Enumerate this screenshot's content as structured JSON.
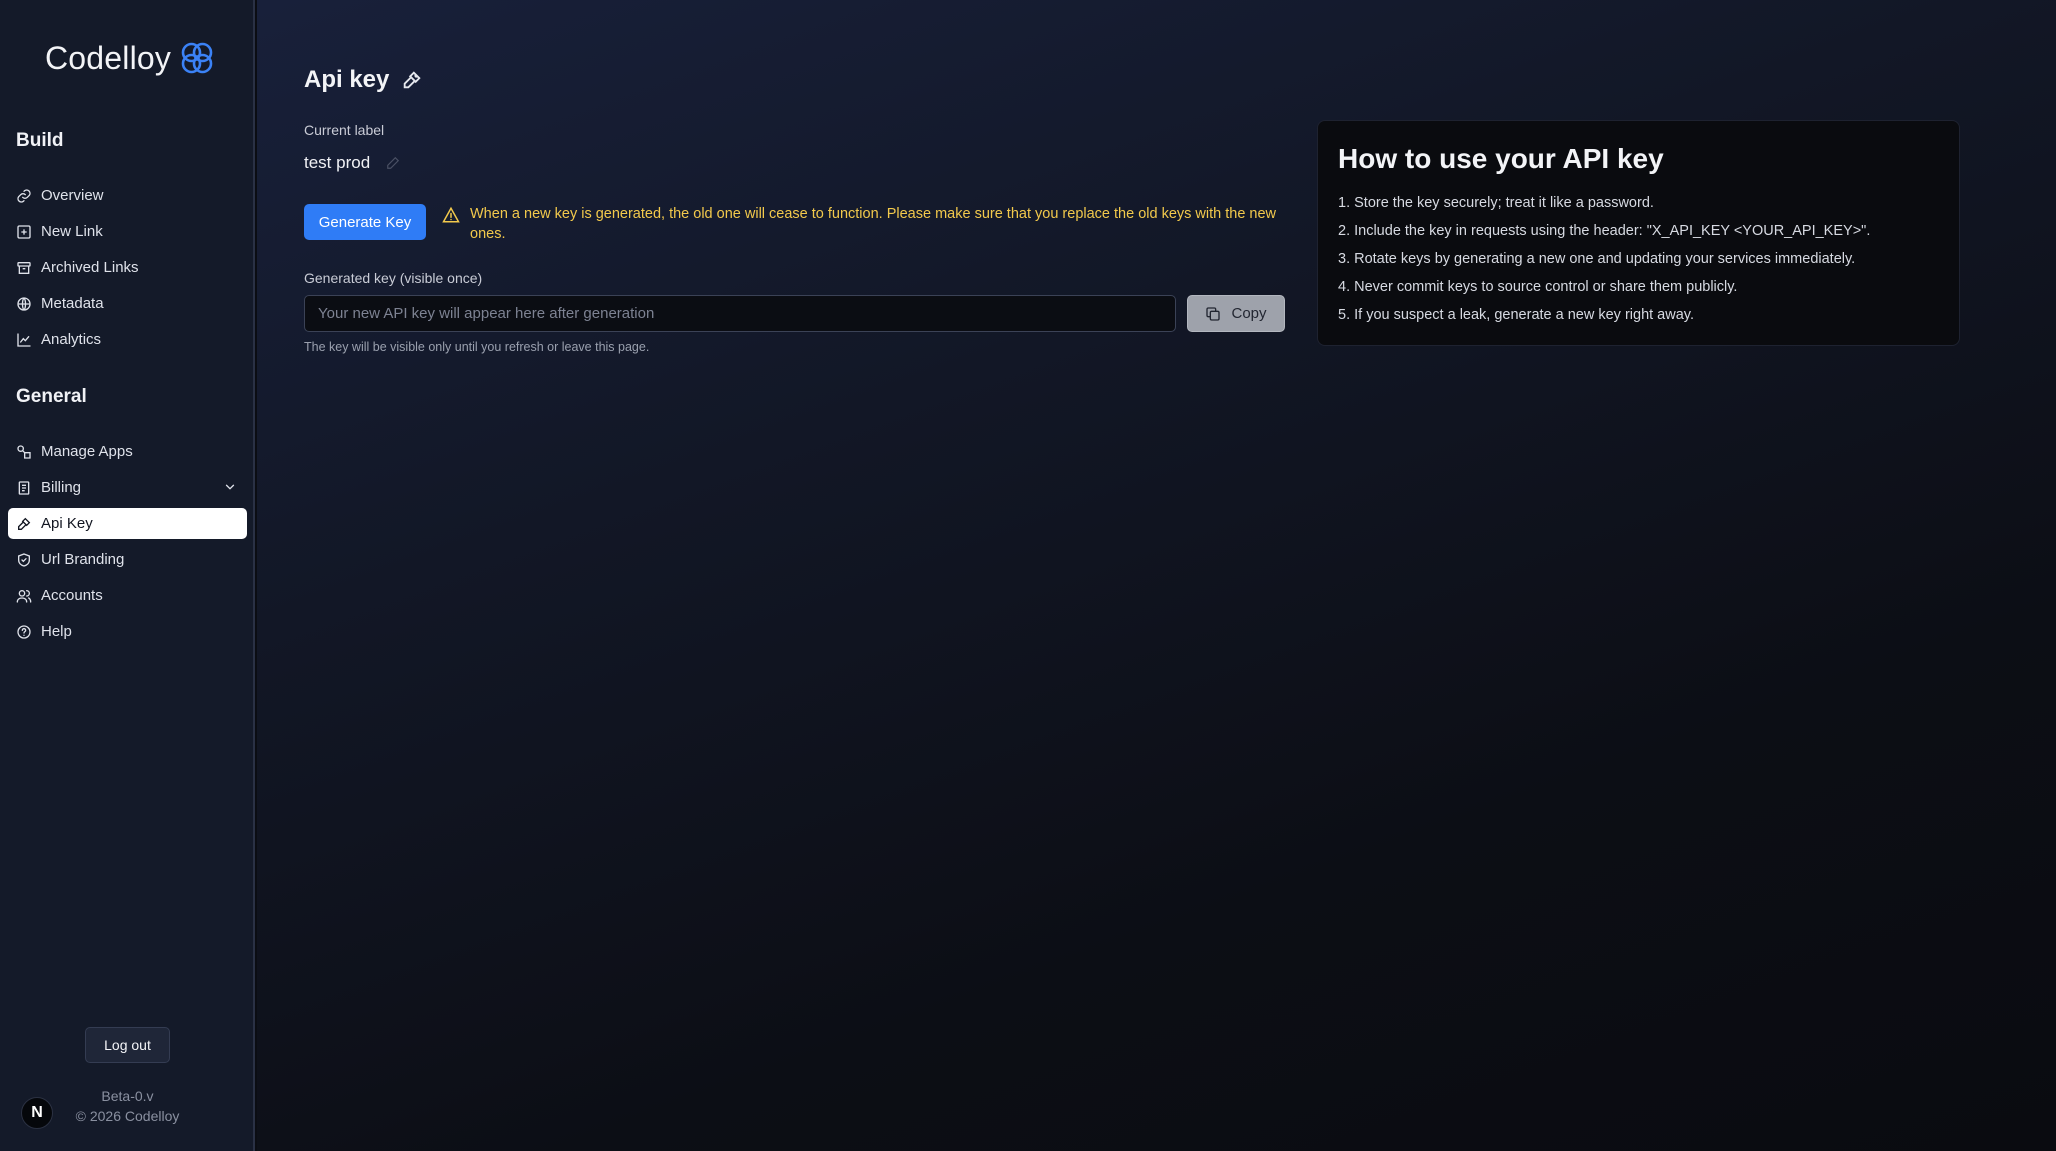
{
  "brand": {
    "name": "Codelloy"
  },
  "sidebar": {
    "sections": [
      {
        "title": "Build",
        "items": [
          {
            "label": "Overview",
            "icon": "link-icon"
          },
          {
            "label": "New Link",
            "icon": "plus-square-icon"
          },
          {
            "label": "Archived Links",
            "icon": "archive-icon"
          },
          {
            "label": "Metadata",
            "icon": "globe-icon"
          },
          {
            "label": "Analytics",
            "icon": "chart-line-icon"
          }
        ]
      },
      {
        "title": "General",
        "items": [
          {
            "label": "Manage Apps",
            "icon": "apps-icon"
          },
          {
            "label": "Billing",
            "icon": "receipt-icon"
          },
          {
            "label": "Api Key",
            "icon": "key-icon",
            "active": true
          },
          {
            "label": "Url Branding",
            "icon": "shield-icon"
          },
          {
            "label": "Accounts",
            "icon": "users-icon"
          },
          {
            "label": "Help",
            "icon": "help-circle-icon"
          }
        ]
      }
    ],
    "logout_label": "Log out",
    "avatar_letter": "N",
    "version": "Beta-0.v",
    "copyright": "© 2026 Codelloy"
  },
  "main": {
    "title": "Api key",
    "current_label_caption": "Current label",
    "current_label_value": "test prod",
    "generate_button": "Generate Key",
    "warning": "When a new key is generated, the old one will cease to function. Please make sure that you replace the old keys with the new ones.",
    "generated_caption": "Generated key (visible once)",
    "key_input": {
      "value": "",
      "placeholder": "Your new API key will appear here after generation"
    },
    "copy_button": "Copy",
    "hint": "The key will be visible only until you refresh or leave this page."
  },
  "help_card": {
    "title": "How to use your API key",
    "steps": [
      "1. Store the key securely; treat it like a password.",
      "2. Include the key in requests using the header: \"X_API_KEY <YOUR_API_KEY>\".",
      "3. Rotate keys by generating a new one and updating your services immediately.",
      "4. Never commit keys to source control or share them publicly.",
      "5. If you suspect a leak, generate a new key right away."
    ]
  },
  "colors": {
    "accent": "#2f7cf6",
    "warning": "#f2c94c",
    "sidebar_bg": "#141a29"
  }
}
